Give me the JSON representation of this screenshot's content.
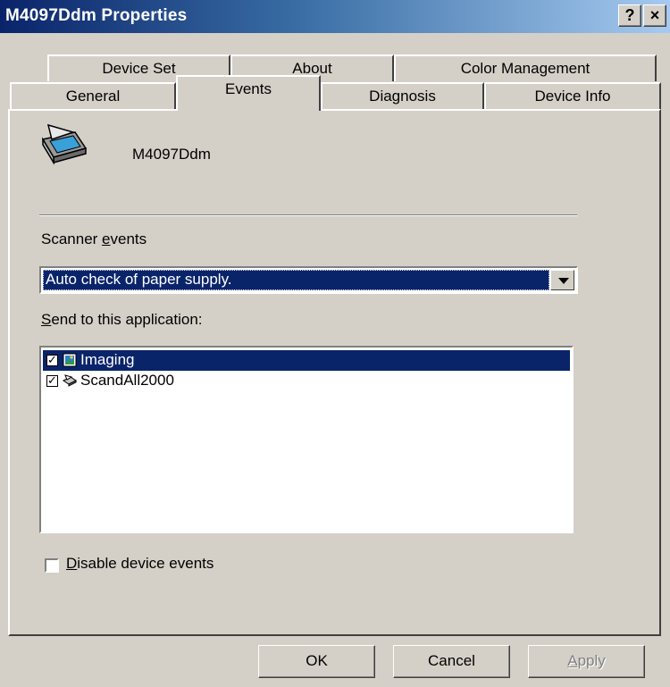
{
  "window": {
    "title": "M4097Ddm Properties",
    "help_label": "?",
    "close_label": "×"
  },
  "tabs": {
    "row1": [
      "Device Set",
      "About",
      "Color Management"
    ],
    "row2": [
      "General",
      "Events",
      "Diagnosis",
      "Device Info"
    ],
    "active": "Events"
  },
  "device": {
    "name": "M4097Ddm",
    "icon": "scanner-icon"
  },
  "scanner_events": {
    "label_prefix": "Scanner ",
    "label_access": "e",
    "label_suffix": "vents",
    "selected": "Auto check of paper supply."
  },
  "send_to": {
    "label_access": "S",
    "label_suffix": "end to this application:",
    "apps": [
      {
        "name": "Imaging",
        "checked": true,
        "selected": true,
        "icon": "imaging-app-icon"
      },
      {
        "name": "ScandAll2000",
        "checked": true,
        "selected": false,
        "icon": "scandall-app-icon"
      }
    ]
  },
  "disable_events": {
    "label_access": "D",
    "label_suffix": "isable device events",
    "checked": false
  },
  "buttons": {
    "ok": "OK",
    "cancel": "Cancel",
    "apply_access": "A",
    "apply_suffix": "pply"
  },
  "colors": {
    "selection": "#0a246a",
    "face": "#d4d0c8"
  }
}
